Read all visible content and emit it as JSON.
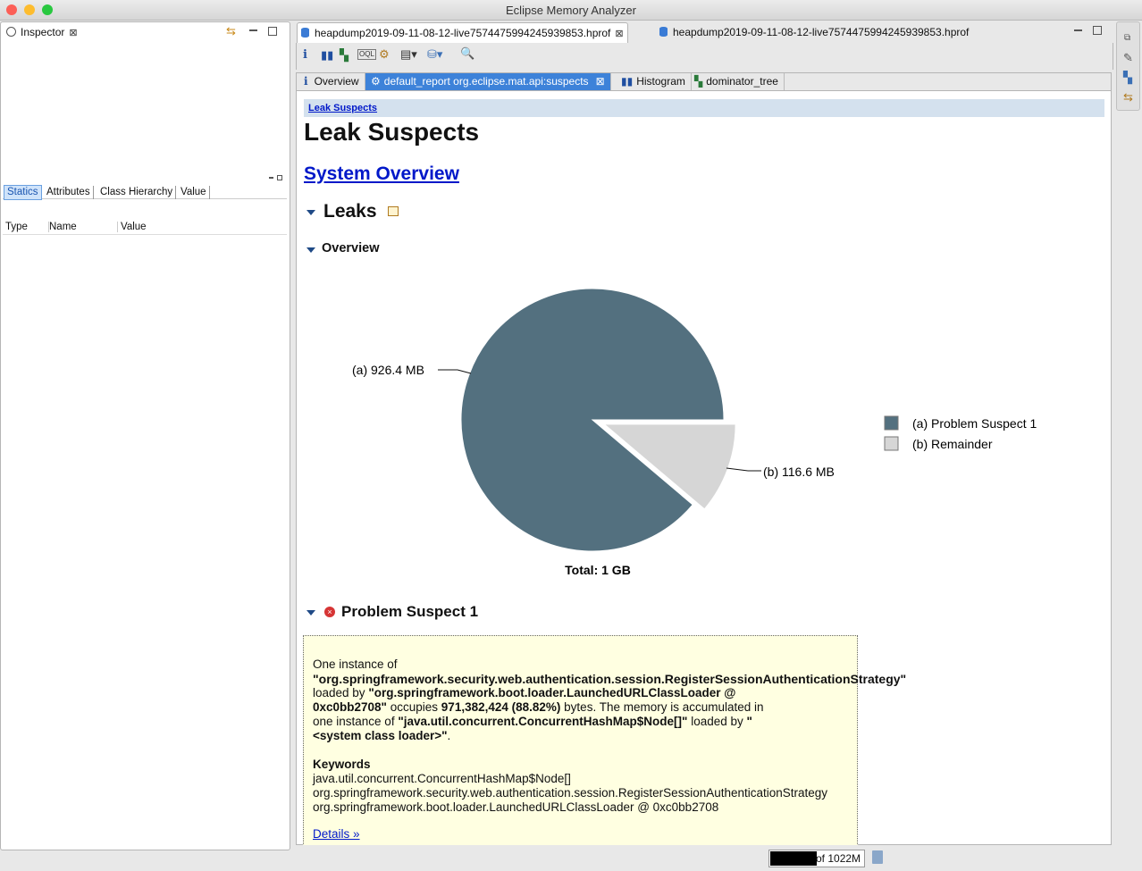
{
  "window": {
    "title": "Eclipse Memory Analyzer"
  },
  "inspector": {
    "tab_label": "Inspector",
    "subtabs": [
      "Statics",
      "Attributes",
      "Class Hierarchy",
      "Value"
    ],
    "columns": [
      "Type",
      "Name",
      "Value"
    ]
  },
  "editor_tabs": [
    {
      "label": "heapdump2019-09-11-08-12-live7574475994245939853.hprof"
    },
    {
      "label": "heapdump2019-09-11-08-12-live7574475994245939853.hprof"
    }
  ],
  "inner_tabs": [
    {
      "label": "Overview"
    },
    {
      "label": "default_report  org.eclipse.mat.api:suspects"
    },
    {
      "label": "Histogram"
    },
    {
      "label": "dominator_tree"
    }
  ],
  "report": {
    "breadcrumb": "Leak Suspects",
    "title": "Leak Suspects",
    "system_overview_link": "System Overview",
    "leaks_heading": "Leaks",
    "overview_heading": "Overview",
    "problem_heading": "Problem Suspect 1",
    "desc": {
      "p1": "One instance of",
      "class_name": "\"org.springframework.security.web.authentication.session.RegisterSessionAuthenticationStrategy\"",
      "p2": "loaded by",
      "loader1": "\"org.springframework.boot.loader.LaunchedURLClassLoader @",
      "loader1b": "0xc0bb2708\"",
      "p3": "occupies",
      "bytes": "971,382,424 (88.82%)",
      "p4": "bytes. The memory is accumulated in",
      "p5": "one instance of",
      "accum_class": "\"java.util.concurrent.ConcurrentHashMap$Node[]\"",
      "p6": "loaded by",
      "loader2a": "\"",
      "loader2b": "<system class loader>\"",
      "p7": "."
    },
    "keywords_heading": "Keywords",
    "keywords": [
      "java.util.concurrent.ConcurrentHashMap$Node[]",
      "org.springframework.security.web.authentication.session.RegisterSessionAuthenticationStrategy",
      "org.springframework.boot.loader.LaunchedURLClassLoader @ 0xc0bb2708"
    ],
    "details_link": "Details »"
  },
  "chart_data": {
    "type": "pie",
    "title": "",
    "total_label": "Total: 1 GB",
    "slices": [
      {
        "key": "(a)",
        "label": "Problem Suspect 1",
        "value_label": "926.4 MB",
        "value": 926.4,
        "color": "#53707f"
      },
      {
        "key": "(b)",
        "label": "Remainder",
        "value_label": "116.6 MB",
        "value": 116.6,
        "color": "#d6d6d6"
      }
    ],
    "legend_position": "right"
  },
  "status": {
    "memory": "of 1022M"
  }
}
